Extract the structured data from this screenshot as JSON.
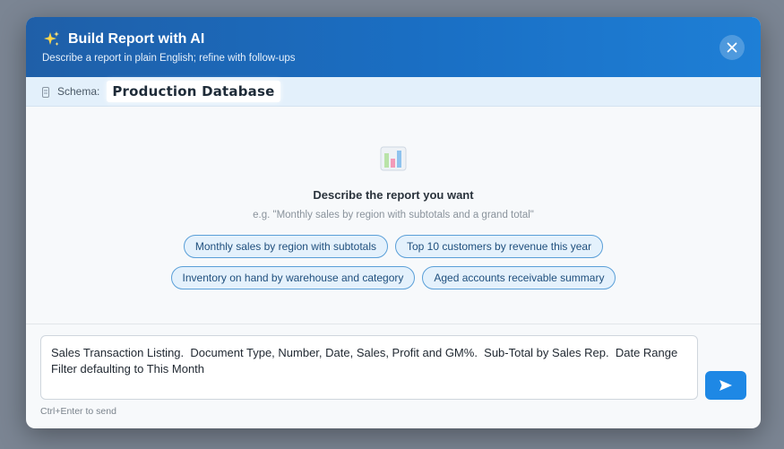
{
  "header": {
    "icon": "sparkle-icon",
    "title": "Build Report with AI",
    "subtitle": "Describe a report in plain English; refine with follow-ups",
    "close_icon": "close-icon",
    "gradient": [
      "#1f5fa8",
      "#1e7fd6"
    ]
  },
  "schema": {
    "icon": "database-icon",
    "label": "Schema:",
    "value": "Production Database"
  },
  "empty_state": {
    "icon": "bar-chart-icon",
    "title": "Describe the report you want",
    "example": "e.g. \"Monthly sales by region with subtotals and a grand total\""
  },
  "suggestions": [
    "Monthly sales by region with subtotals",
    "Top 10 customers by revenue this year",
    "Inventory on hand by warehouse and category",
    "Aged accounts receivable summary"
  ],
  "composer": {
    "value": "Sales Transaction Listing.  Document Type, Number, Date, Sales, Profit and GM%.  Sub-Total by Sales Rep.  Date Range Filter defaulting to This Month",
    "send_icon": "send-icon",
    "hint": "Ctrl+Enter to send"
  },
  "colors": {
    "accent": "#1e88e5",
    "chip_border": "#5a9fd8",
    "chip_bg": "#e4f1fc"
  }
}
